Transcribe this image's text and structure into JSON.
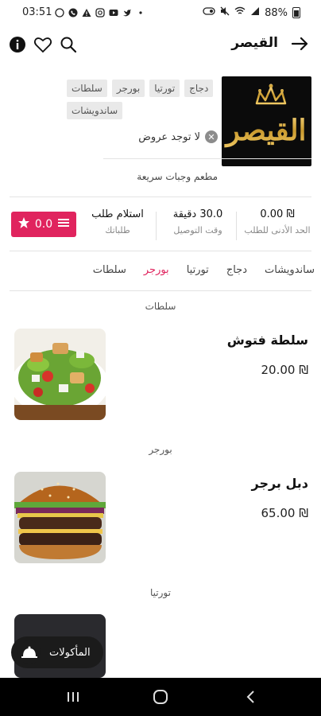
{
  "status_bar": {
    "time": "03:51",
    "battery": "88%",
    "left_icons": [
      "whatsapp-icon",
      "phone-icon",
      "warning-icon",
      "instagram-icon",
      "youtube-icon",
      "twitter-icon",
      "dot-icon"
    ],
    "right_icons": [
      "nfc-icon",
      "mute-icon",
      "wifi-icon",
      "signal-icon",
      "battery-icon"
    ]
  },
  "header": {
    "title": "القيصر",
    "icons": [
      "back-arrow-icon",
      "search-icon",
      "heart-icon",
      "info-icon"
    ]
  },
  "restaurant": {
    "tags": [
      "سلطات",
      "بورجر",
      "تورتيا",
      "دجاج",
      "ساندويشات"
    ],
    "no_offers": "لا توجد عروض",
    "subtitle": "مطعم وجبات سريعة",
    "logo_text": "القيصر"
  },
  "stats": {
    "rating": "0.0",
    "pickup_value": "استلام طلب",
    "pickup_label": "طلباتك",
    "delivery_value": "30.0 دقيقة",
    "delivery_label": "وقت التوصيل",
    "min_order_value": "₪ 0.00",
    "min_order_label": "الحد الأدنى للطلب"
  },
  "categories": {
    "tabs": [
      "سلطات",
      "بورجر",
      "تورتيا",
      "دجاج",
      "ساندويشات"
    ],
    "active_index": 1
  },
  "sections": [
    {
      "label": "سلطات",
      "item_title": "سلطة فتوش",
      "item_price": "₪ 20.00"
    },
    {
      "label": "بورجر",
      "item_title": "دبل برجر",
      "item_price": "₪ 65.00"
    },
    {
      "label": "تورتيا"
    }
  ],
  "fab": {
    "label": "المأكولات"
  },
  "colors": {
    "accent": "#e0245e",
    "dark": "#1b1b1b"
  }
}
